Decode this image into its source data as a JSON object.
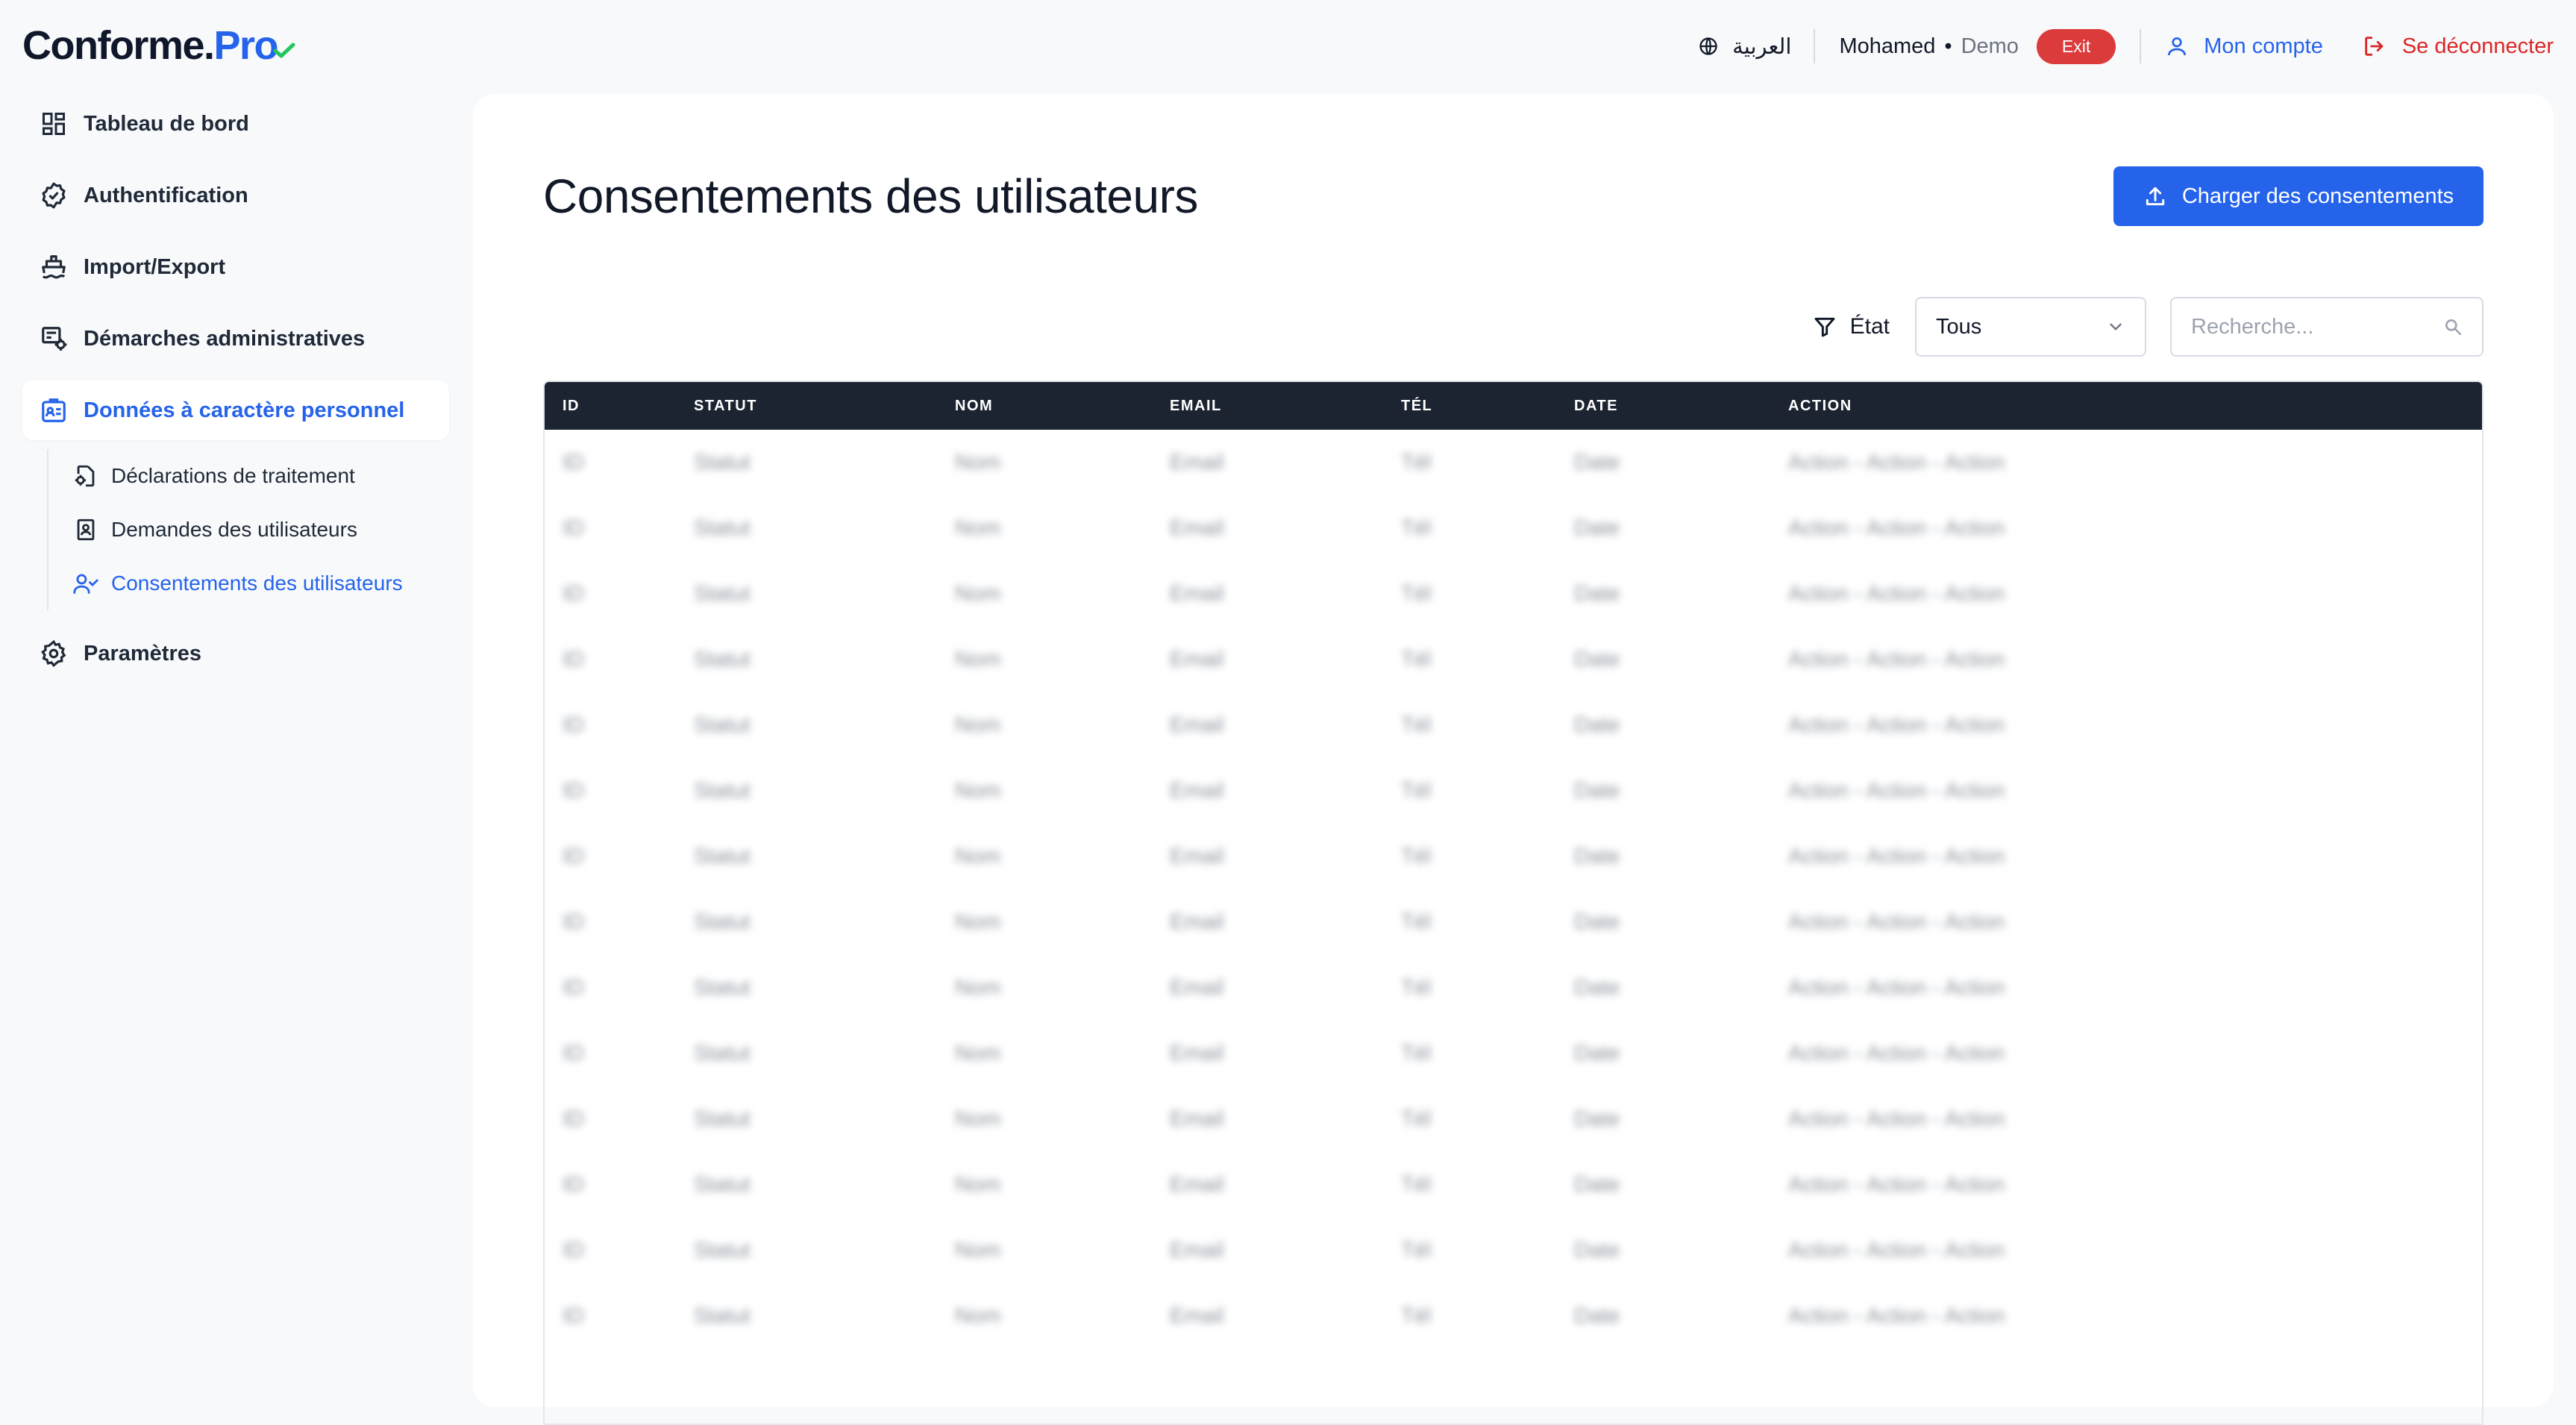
{
  "brand": {
    "name_main": "Conforme.",
    "name_pro": "Pro"
  },
  "topbar": {
    "language": "العربية",
    "user_name": "Mohamed",
    "separator": "•",
    "user_role": "Demo",
    "exit_label": "Exit",
    "account_label": "Mon compte",
    "logout_label": "Se déconnecter"
  },
  "sidebar": {
    "items": [
      {
        "label": "Tableau de bord",
        "icon": "dashboard-icon"
      },
      {
        "label": "Authentification",
        "icon": "badge-check-icon"
      },
      {
        "label": "Import/Export",
        "icon": "ship-icon"
      },
      {
        "label": "Démarches administratives",
        "icon": "workflow-icon"
      },
      {
        "label": "Données à caractère personnel",
        "icon": "id-card-icon",
        "active": true
      },
      {
        "label": "Paramètres",
        "icon": "gear-icon"
      }
    ],
    "subitems": [
      {
        "label": "Déclarations de traitement",
        "icon": "file-cog-icon"
      },
      {
        "label": "Demandes des utilisateurs",
        "icon": "user-file-icon"
      },
      {
        "label": "Consentements des utilisateurs",
        "icon": "user-check-icon",
        "active": true
      }
    ]
  },
  "main": {
    "title": "Consentements des utilisateurs",
    "upload_label": "Charger des consentements",
    "filter_label": "État",
    "filter_value": "Tous",
    "search_placeholder": "Recherche..."
  },
  "table": {
    "columns": [
      "ID",
      "STATUT",
      "NOM",
      "EMAIL",
      "TÉL",
      "DATE",
      "ACTION"
    ],
    "rows": [
      [
        "ID",
        "Statut",
        "Nom",
        "Email",
        "Tél",
        "Date",
        "Action - Action - Action"
      ],
      [
        "ID",
        "Statut",
        "Nom",
        "Email",
        "Tél",
        "Date",
        "Action - Action - Action"
      ],
      [
        "ID",
        "Statut",
        "Nom",
        "Email",
        "Tél",
        "Date",
        "Action - Action - Action"
      ],
      [
        "ID",
        "Statut",
        "Nom",
        "Email",
        "Tél",
        "Date",
        "Action - Action - Action"
      ],
      [
        "ID",
        "Statut",
        "Nom",
        "Email",
        "Tél",
        "Date",
        "Action - Action - Action"
      ],
      [
        "ID",
        "Statut",
        "Nom",
        "Email",
        "Tél",
        "Date",
        "Action - Action - Action"
      ],
      [
        "ID",
        "Statut",
        "Nom",
        "Email",
        "Tél",
        "Date",
        "Action - Action - Action"
      ],
      [
        "ID",
        "Statut",
        "Nom",
        "Email",
        "Tél",
        "Date",
        "Action - Action - Action"
      ],
      [
        "ID",
        "Statut",
        "Nom",
        "Email",
        "Tél",
        "Date",
        "Action - Action - Action"
      ],
      [
        "ID",
        "Statut",
        "Nom",
        "Email",
        "Tél",
        "Date",
        "Action - Action - Action"
      ],
      [
        "ID",
        "Statut",
        "Nom",
        "Email",
        "Tél",
        "Date",
        "Action - Action - Action"
      ],
      [
        "ID",
        "Statut",
        "Nom",
        "Email",
        "Tél",
        "Date",
        "Action - Action - Action"
      ],
      [
        "ID",
        "Statut",
        "Nom",
        "Email",
        "Tél",
        "Date",
        "Action - Action - Action"
      ],
      [
        "ID",
        "Statut",
        "Nom",
        "Email",
        "Tél",
        "Date",
        "Action - Action - Action"
      ]
    ]
  },
  "colors": {
    "accent": "#2563eb",
    "danger": "#dc2626",
    "exit_badge": "#dc3b3b",
    "table_header": "#1c2431",
    "background": "#f8f9fb",
    "check_green": "#22c55e"
  }
}
